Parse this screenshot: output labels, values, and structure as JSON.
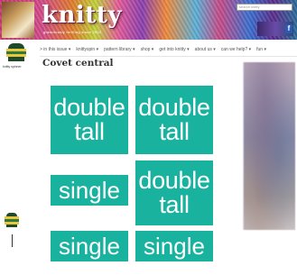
{
  "header": {
    "logo": "knitty",
    "tagline": "gratuitously thrilling since 2002",
    "search_placeholder": "search knitty",
    "social_icon_glyph": "f"
  },
  "sidebar": {
    "caption": "knitty spinner"
  },
  "nav": {
    "items": [
      {
        "label": "> in this issue ▾"
      },
      {
        "label": "knittyspin ▾"
      },
      {
        "label": "pattern library ▾"
      },
      {
        "label": "shop ▾"
      },
      {
        "label": "get into knitty ▾"
      },
      {
        "label": "about us ▾"
      },
      {
        "label": "can we help? ▾"
      },
      {
        "label": "fun ▾"
      }
    ]
  },
  "page": {
    "title": "Covet central"
  },
  "tiles": [
    {
      "line1": "double",
      "line2": "tall"
    },
    {
      "line1": "double",
      "line2": "tall"
    },
    {
      "line1": "single"
    },
    {
      "line1": "double",
      "line2": "tall"
    },
    {
      "line1": "single"
    },
    {
      "line1": "single"
    }
  ],
  "colors": {
    "tile": "#18b29e",
    "title_text": "#333333"
  }
}
